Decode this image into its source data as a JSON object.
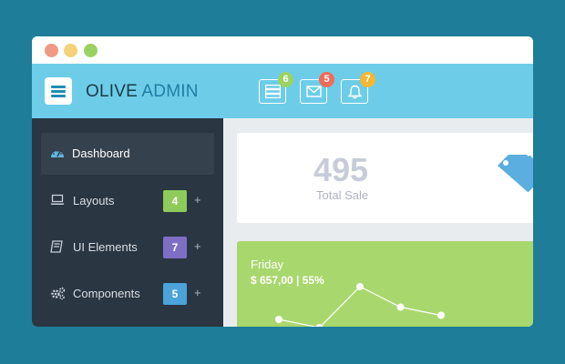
{
  "header": {
    "brand_part1": "OLIVE",
    "brand_part2": "ADMIN",
    "icons": [
      {
        "name": "server-icon",
        "badge": "6",
        "badge_color": "#9ad264"
      },
      {
        "name": "mail-icon",
        "badge": "5",
        "badge_color": "#ef6b5b"
      },
      {
        "name": "bell-icon",
        "badge": "7",
        "badge_color": "#f3b731"
      }
    ]
  },
  "sidebar": {
    "items": [
      {
        "label": "Dashboard",
        "icon": "dashboard-icon",
        "active": true
      },
      {
        "label": "Layouts",
        "icon": "laptop-icon",
        "badge": "4",
        "badge_color": "#8fcb5a",
        "plus": "+"
      },
      {
        "label": "UI Elements",
        "icon": "book-icon",
        "badge": "7",
        "badge_color": "#7e6fc5",
        "plus": "+"
      },
      {
        "label": "Components",
        "icon": "gears-icon",
        "badge": "5",
        "badge_color": "#4ba3d9",
        "plus": "+"
      }
    ]
  },
  "stats": {
    "total_sale_value": "495",
    "total_sale_label": "Total Sale",
    "icon": "tag-icon"
  },
  "chart_card": {
    "day": "Friday",
    "summary": "$ 657,00 | 55%",
    "bg_color": "#a8d86d"
  },
  "chart_data": {
    "type": "line",
    "values": [
      12,
      10,
      20,
      15,
      13
    ],
    "title": "",
    "xlabel": "",
    "ylabel": ""
  },
  "colors": {
    "header": "#6dcde8",
    "sidebar": "#2a3642",
    "background": "#1e7d99"
  }
}
